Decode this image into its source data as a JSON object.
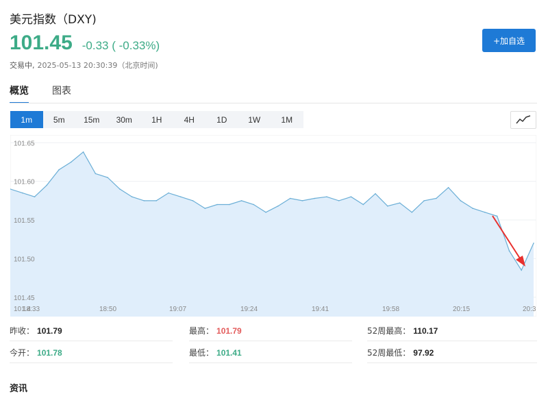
{
  "header": {
    "title": "美元指数（DXY)",
    "price": "101.45",
    "change": "-0.33 ( -0.33%)",
    "status": "交易中,",
    "timestamp": "2025-05-13 20:30:39（北京时间)",
    "add_watchlist": "+加自选"
  },
  "tabs": [
    {
      "label": "概览",
      "active": true
    },
    {
      "label": "图表",
      "active": false
    }
  ],
  "periods": [
    {
      "label": "1m",
      "active": true
    },
    {
      "label": "5m",
      "active": false
    },
    {
      "label": "15m",
      "active": false
    },
    {
      "label": "30m",
      "active": false
    },
    {
      "label": "1H",
      "active": false
    },
    {
      "label": "4H",
      "active": false
    },
    {
      "label": "1D",
      "active": false
    },
    {
      "label": "1W",
      "active": false
    },
    {
      "label": "1M",
      "active": false
    }
  ],
  "chart_type_icon": "line-chart-icon",
  "chart_data": {
    "type": "area",
    "x": [
      "18:33",
      "18:36",
      "18:39",
      "18:42",
      "18:45",
      "18:48",
      "18:50",
      "18:53",
      "18:56",
      "18:59",
      "19:02",
      "19:05",
      "19:07",
      "19:10",
      "19:13",
      "19:16",
      "19:19",
      "19:22",
      "19:24",
      "19:27",
      "19:30",
      "19:33",
      "19:36",
      "19:39",
      "19:41",
      "19:44",
      "19:47",
      "19:50",
      "19:53",
      "19:56",
      "19:58",
      "20:01",
      "20:04",
      "20:07",
      "20:10",
      "20:13",
      "20:15",
      "20:18",
      "20:21",
      "20:24",
      "20:27",
      "20:28",
      "20:29",
      "20:30"
    ],
    "values": [
      101.59,
      101.585,
      101.58,
      101.595,
      101.615,
      101.625,
      101.638,
      101.61,
      101.605,
      101.59,
      101.58,
      101.575,
      101.575,
      101.585,
      101.58,
      101.575,
      101.565,
      101.57,
      101.57,
      101.575,
      101.57,
      101.56,
      101.568,
      101.578,
      101.575,
      101.578,
      101.58,
      101.575,
      101.58,
      101.57,
      101.584,
      101.568,
      101.572,
      101.56,
      101.575,
      101.578,
      101.592,
      101.575,
      101.565,
      101.56,
      101.555,
      101.51,
      101.485,
      101.52
    ],
    "ylim": [
      101.425,
      101.66
    ],
    "yticks": [
      "101.65",
      "101.60",
      "101.55",
      "101.50",
      "101.45"
    ],
    "xticks": [
      "18:33",
      "18:50",
      "19:07",
      "19:24",
      "19:41",
      "19:58",
      "20:15",
      "20:3"
    ],
    "yfirst_label": "101.4",
    "line_color": "#6aaed6",
    "fill_color": "#e0eefb",
    "arrow_color": "#e8302e",
    "grid": true
  },
  "stats": {
    "prev_close_label": "昨收：",
    "prev_close": "101.79",
    "high_label": "最高：",
    "high": "101.79",
    "high52_label": "52周最高：",
    "high52": "110.17",
    "open_label": "今开：",
    "open": "101.78",
    "low_label": "最低：",
    "low": "101.41",
    "low52_label": "52周最低：",
    "low52": "97.92"
  },
  "news_title": "资讯",
  "colors": {
    "accent": "#1e7ad6",
    "down": "#3dab87",
    "up": "#e35b5b"
  }
}
